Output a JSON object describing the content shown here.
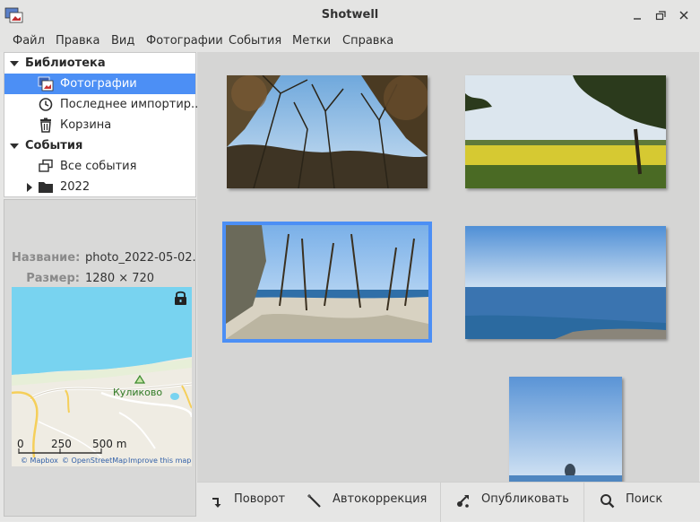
{
  "window": {
    "title": "Shotwell",
    "controls": [
      "minimize",
      "maximize",
      "close"
    ]
  },
  "menubar": {
    "items": [
      {
        "label": "Файл"
      },
      {
        "label": "Правка"
      },
      {
        "label": "Вид"
      },
      {
        "label": "Фотографии"
      },
      {
        "label": "События"
      },
      {
        "label": "Метки"
      },
      {
        "label": "Справка"
      }
    ]
  },
  "sidebar": {
    "library_label": "Библиотека",
    "items": [
      {
        "label": "Фотографии",
        "icon": "photos-icon",
        "selected": true
      },
      {
        "label": "Последнее импортир...",
        "icon": "clock-icon"
      },
      {
        "label": "Корзина",
        "icon": "trash-icon"
      }
    ],
    "events_label": "События",
    "event_items": [
      {
        "label": "Все события",
        "icon": "events-icon"
      },
      {
        "label": "2022",
        "icon": "folder-icon",
        "expandable": true
      }
    ]
  },
  "info": {
    "name_key": "Название:",
    "name_value": "photo_2022-05-02...",
    "size_key": "Размер:",
    "size_value": "1280 × 720"
  },
  "map": {
    "place_label": "Куликово",
    "scale_0": "0",
    "scale_250": "250",
    "scale_500": "500 m",
    "credit_mapbox": "© Mapbox",
    "credit_osm": "© OpenStreetMap",
    "credit_improve": "Improve this map",
    "colors": {
      "sea": "#78d3f0",
      "land": "#efece3",
      "road": "#f5cf5a"
    }
  },
  "photos": [
    {
      "name": "forest-sky-photo",
      "selected": false
    },
    {
      "name": "rapeseed-field-photo",
      "selected": false
    },
    {
      "name": "beach-trees-photo",
      "selected": true
    },
    {
      "name": "sea-horizon-photo",
      "selected": false
    },
    {
      "name": "sea-sky-portrait-photo",
      "selected": false
    }
  ],
  "toolbar": {
    "rotate_label": "Поворот",
    "enhance_label": "Автокоррекция",
    "publish_label": "Опубликовать",
    "search_label": "Поиск"
  },
  "colors": {
    "selection": "#4c8ff5",
    "grid_bg": "#d5d5d4"
  }
}
